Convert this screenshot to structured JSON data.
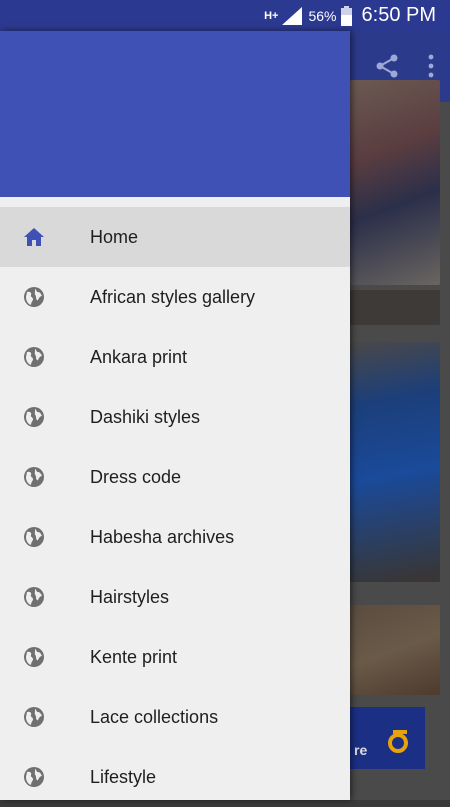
{
  "status_bar": {
    "network": "H+",
    "battery_percent": "56%",
    "time": "6:50 PM",
    "background_color": "#2b3990"
  },
  "toolbar": {
    "actions": [
      "share-icon",
      "more-vert-icon"
    ],
    "color": "#2c3a8c"
  },
  "drawer": {
    "header_color": "#3f51b5",
    "items": [
      {
        "label": "Home",
        "icon": "home-icon",
        "active": true
      },
      {
        "label": "African styles gallery",
        "icon": "globe-icon",
        "active": false
      },
      {
        "label": "Ankara print",
        "icon": "globe-icon",
        "active": false
      },
      {
        "label": "Dashiki styles",
        "icon": "globe-icon",
        "active": false
      },
      {
        "label": "Dress code",
        "icon": "globe-icon",
        "active": false
      },
      {
        "label": "Habesha archives",
        "icon": "globe-icon",
        "active": false
      },
      {
        "label": "Hairstyles",
        "icon": "globe-icon",
        "active": false
      },
      {
        "label": "Kente print",
        "icon": "globe-icon",
        "active": false
      },
      {
        "label": "Lace collections",
        "icon": "globe-icon",
        "active": false
      },
      {
        "label": "Lifestyle",
        "icon": "globe-icon",
        "active": false
      }
    ]
  },
  "banner": {
    "text": "re"
  }
}
